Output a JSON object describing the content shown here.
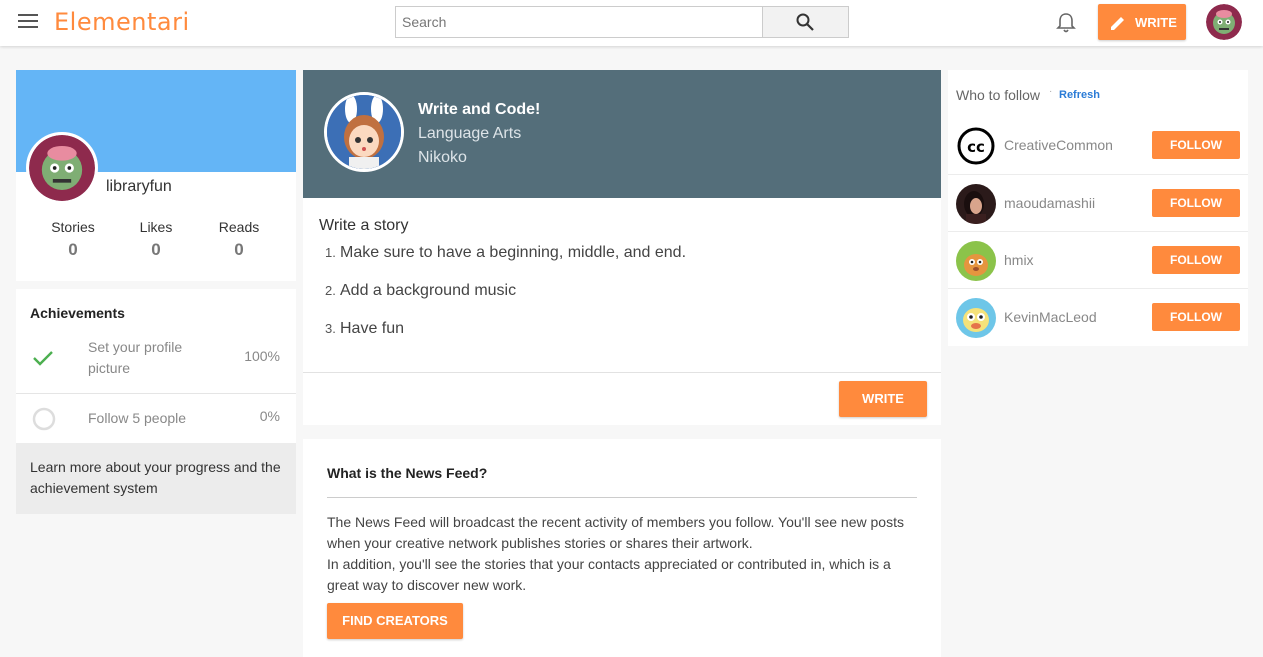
{
  "app": {
    "logo": "Elementari",
    "search_placeholder": "Search",
    "write_label": "WRITE",
    "accent_color": "#ff8a3d"
  },
  "profile": {
    "username": "libraryfun",
    "stats": [
      {
        "label": "Stories",
        "value": "0"
      },
      {
        "label": "Likes",
        "value": "0"
      },
      {
        "label": "Reads",
        "value": "0"
      }
    ]
  },
  "achievements": {
    "title": "Achievements",
    "items": [
      {
        "label": "Set your profile picture",
        "percent": "100%",
        "done": true
      },
      {
        "label": "Follow 5 people",
        "percent": "0%",
        "done": false
      }
    ],
    "footer": "Learn more about your progress and the achievement system"
  },
  "prompt": {
    "title": "Write and Code!",
    "subject": "Language Arts",
    "author": "Nikoko",
    "body_title": "Write a story",
    "steps": [
      "Make sure to have a beginning, middle, and end.",
      "Add a background music",
      "Have fun"
    ],
    "write_label": "WRITE"
  },
  "news_feed": {
    "title": "What is the News Feed?",
    "lines": [
      "The News Feed will broadcast the recent activity of members you follow. You'll see new posts when your creative network publishes stories or shares their artwork.",
      "In addition, you'll see the stories that your contacts appreciated or contributed in, which is a great way to discover new work."
    ],
    "button": "FIND CREATORS"
  },
  "who_to_follow": {
    "title": "Who to follow",
    "separator": "·",
    "refresh": "Refresh",
    "follow_label": "FOLLOW",
    "users": [
      {
        "name": "CreativeCommon"
      },
      {
        "name": "maoudamashii"
      },
      {
        "name": "hmix"
      },
      {
        "name": "KevinMacLeod"
      }
    ]
  }
}
